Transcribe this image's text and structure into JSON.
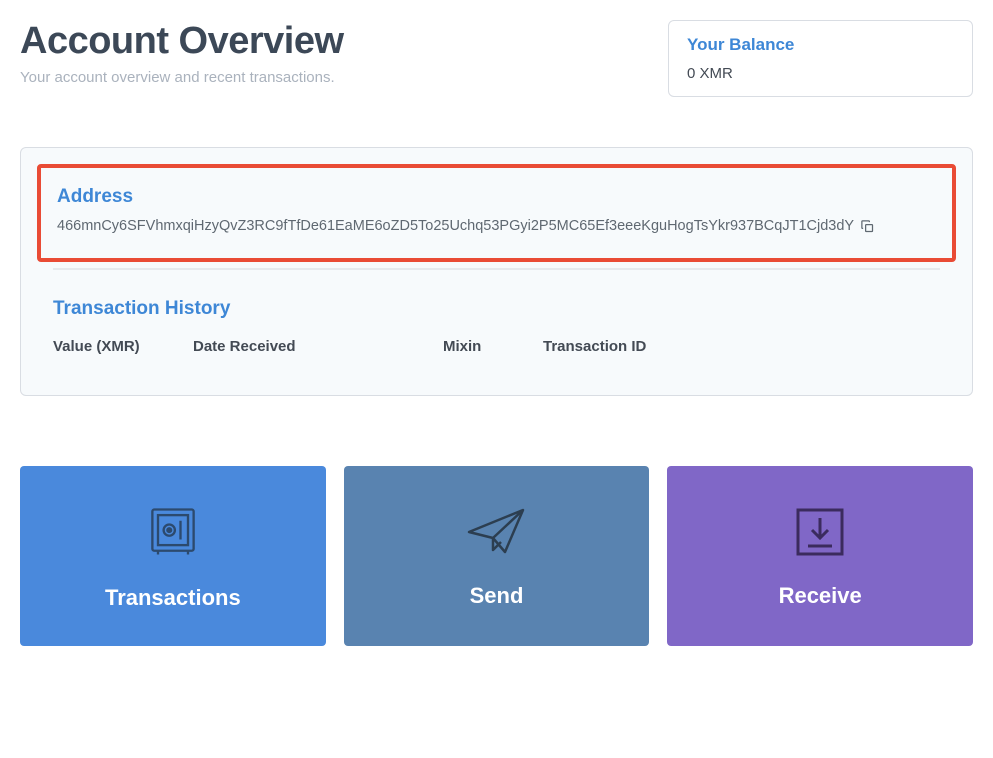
{
  "header": {
    "title": "Account Overview",
    "subtitle": "Your account overview and recent transactions."
  },
  "balance": {
    "label": "Your Balance",
    "value": "0 XMR"
  },
  "address": {
    "label": "Address",
    "value": "466mnCy6SFVhmxqiHzyQvZ3RC9fTfDe61EaME6oZD5To25Uchq53PGyi2P5MC65Ef3eeeKguHogTsYkr937BCqJT1Cjd3dY"
  },
  "transactions": {
    "label": "Transaction History",
    "columns": {
      "value": "Value (XMR)",
      "date": "Date Received",
      "mixin": "Mixin",
      "txid": "Transaction ID"
    }
  },
  "actions": {
    "transactions": "Transactions",
    "send": "Send",
    "receive": "Receive"
  }
}
